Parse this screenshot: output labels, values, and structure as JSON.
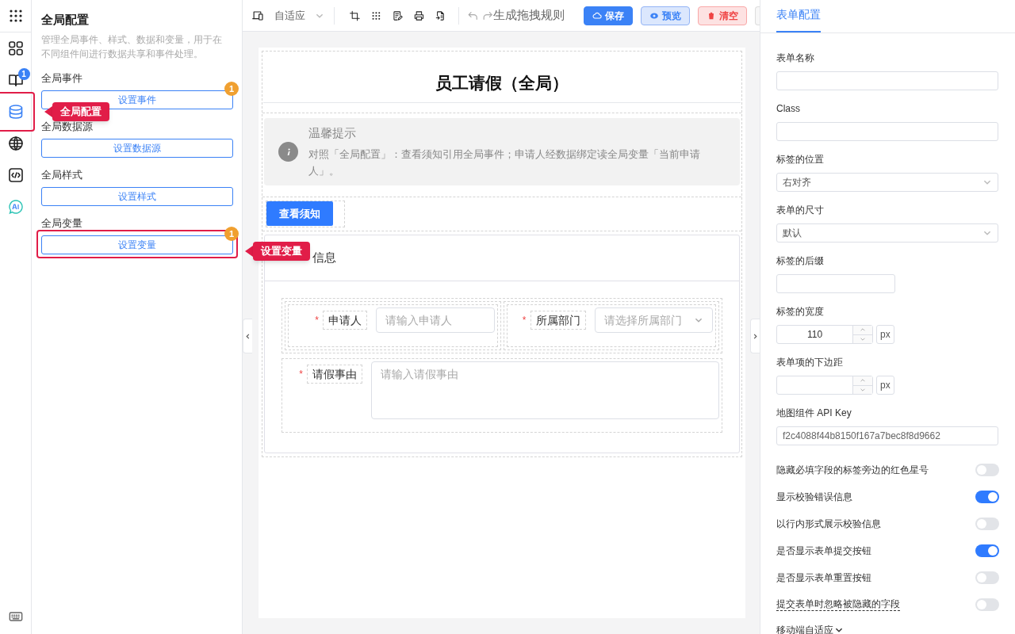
{
  "rail": [
    {
      "kind": "apps",
      "selected": false
    },
    {
      "kind": "grid",
      "selected": false
    },
    {
      "kind": "book",
      "selected": false,
      "badge": "1"
    },
    {
      "kind": "database",
      "selected": true
    },
    {
      "kind": "globe",
      "selected": false
    },
    {
      "kind": "code",
      "selected": false
    },
    {
      "kind": "ai",
      "selected": false
    }
  ],
  "global_panel": {
    "title": "全局配置",
    "description": "管理全局事件、样式、数据和变量，用于在不同组件间进行数据共享和事件处理。",
    "sections": [
      {
        "label": "全局事件",
        "button": "设置事件",
        "badge": "1",
        "highlighted": false
      },
      {
        "label": "全局数据源",
        "button": "设置数据源",
        "highlighted": false
      },
      {
        "label": "全局样式",
        "button": "设置样式",
        "highlighted": false
      },
      {
        "label": "全局变量",
        "button": "设置变量",
        "badge": "1",
        "highlighted": true
      }
    ]
  },
  "callouts": [
    {
      "text": "全局配置"
    },
    {
      "text": "设置变量"
    }
  ],
  "toolbar": {
    "device": "自适应",
    "items": [
      {
        "kind": "crop"
      },
      {
        "kind": "grid"
      },
      {
        "kind": "edit"
      },
      {
        "kind": "print"
      },
      {
        "kind": "import"
      }
    ],
    "rule_text": "生成拖拽规则",
    "buttons": [
      {
        "label": "保存",
        "kind": "save"
      },
      {
        "label": "预览",
        "kind": "preview"
      },
      {
        "label": "清空",
        "kind": "clear"
      }
    ]
  },
  "form": {
    "title": "员工请假（全局）",
    "alert": {
      "title": "温馨提示",
      "text": "对照「全局配置」：查看须知引用全局事件；申请人经数据绑定读全局变量「当前申请人」。"
    },
    "button": "查看须知",
    "card_title": "信息",
    "row_fields": [
      {
        "label": "申请人",
        "required_mark": "*",
        "kind": "input",
        "placeholder": "请输入申请人"
      },
      {
        "label": "所属部门",
        "required_mark": "*",
        "kind": "select",
        "placeholder": "请选择所属部门"
      }
    ],
    "textarea": {
      "label": "请假事由",
      "required_mark": "*",
      "placeholder": "请输入请假事由"
    }
  },
  "settings": {
    "tab": "表单配置",
    "items": [
      {
        "kind": "input",
        "label": "表单名称",
        "value": ""
      },
      {
        "kind": "input",
        "label": "Class",
        "value": ""
      },
      {
        "kind": "select",
        "label": "标签的位置",
        "value": "右对齐"
      },
      {
        "kind": "select",
        "label": "表单的尺寸",
        "value": "默认"
      },
      {
        "kind": "short",
        "label": "标签的后缀",
        "value": ""
      },
      {
        "kind": "number",
        "label": "标签的宽度",
        "value": "110",
        "unit": "px"
      },
      {
        "kind": "number",
        "label": "表单项的下边距",
        "value": "",
        "unit": "px"
      },
      {
        "kind": "input",
        "label": "地图组件 API Key",
        "value": "f2c4088f44b8150f167a7bec8f8d9662"
      },
      {
        "kind": "toggle",
        "label": "隐藏必填字段的标签旁边的红色星号",
        "on": false
      },
      {
        "kind": "toggle",
        "label": "显示校验错误信息",
        "on": true
      },
      {
        "kind": "toggle",
        "label": "以行内形式展示校验信息",
        "on": false
      },
      {
        "kind": "toggle",
        "label": "是否显示表单提交按钮",
        "on": true
      },
      {
        "kind": "toggle",
        "label": "是否显示表单重置按钮",
        "on": false
      },
      {
        "kind": "toggle",
        "label": "提交表单时忽略被隐藏的字段",
        "on": false,
        "underlined": true
      },
      {
        "kind": "expander",
        "label": "移动端自适应"
      }
    ]
  }
}
